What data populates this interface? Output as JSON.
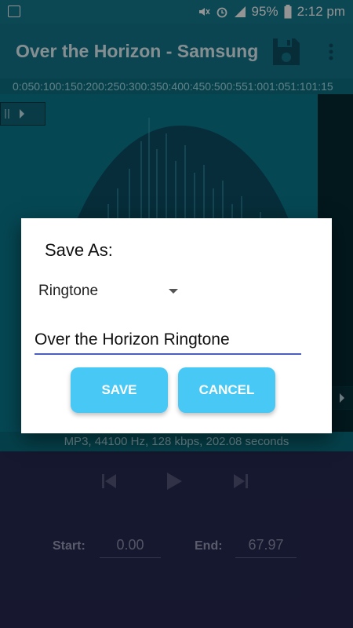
{
  "status_bar": {
    "battery": "95%",
    "time": "2:12 pm"
  },
  "app_bar": {
    "title": "Over the Horizon - Samsung"
  },
  "timeline": {
    "ticks": "0:050:100:150:200:250:300:350:400:450:500:551:001:051:101:15"
  },
  "waveform": {
    "file_info": "MP3, 44100 Hz, 128 kbps, 202.08 seconds"
  },
  "controls": {
    "start_label": "Start:",
    "start_value": "0.00",
    "end_label": "End:",
    "end_value": "67.97"
  },
  "dialog": {
    "heading": "Save As:",
    "type_selected": "Ringtone",
    "name_value": "Over the Horizon Ringtone",
    "save_label": "SAVE",
    "cancel_label": "CANCEL"
  },
  "colors": {
    "app_bar": "#13778d",
    "bottom_panel": "#272a51",
    "accent_button": "#48c8f5",
    "field_underline": "#4a5fc1"
  }
}
